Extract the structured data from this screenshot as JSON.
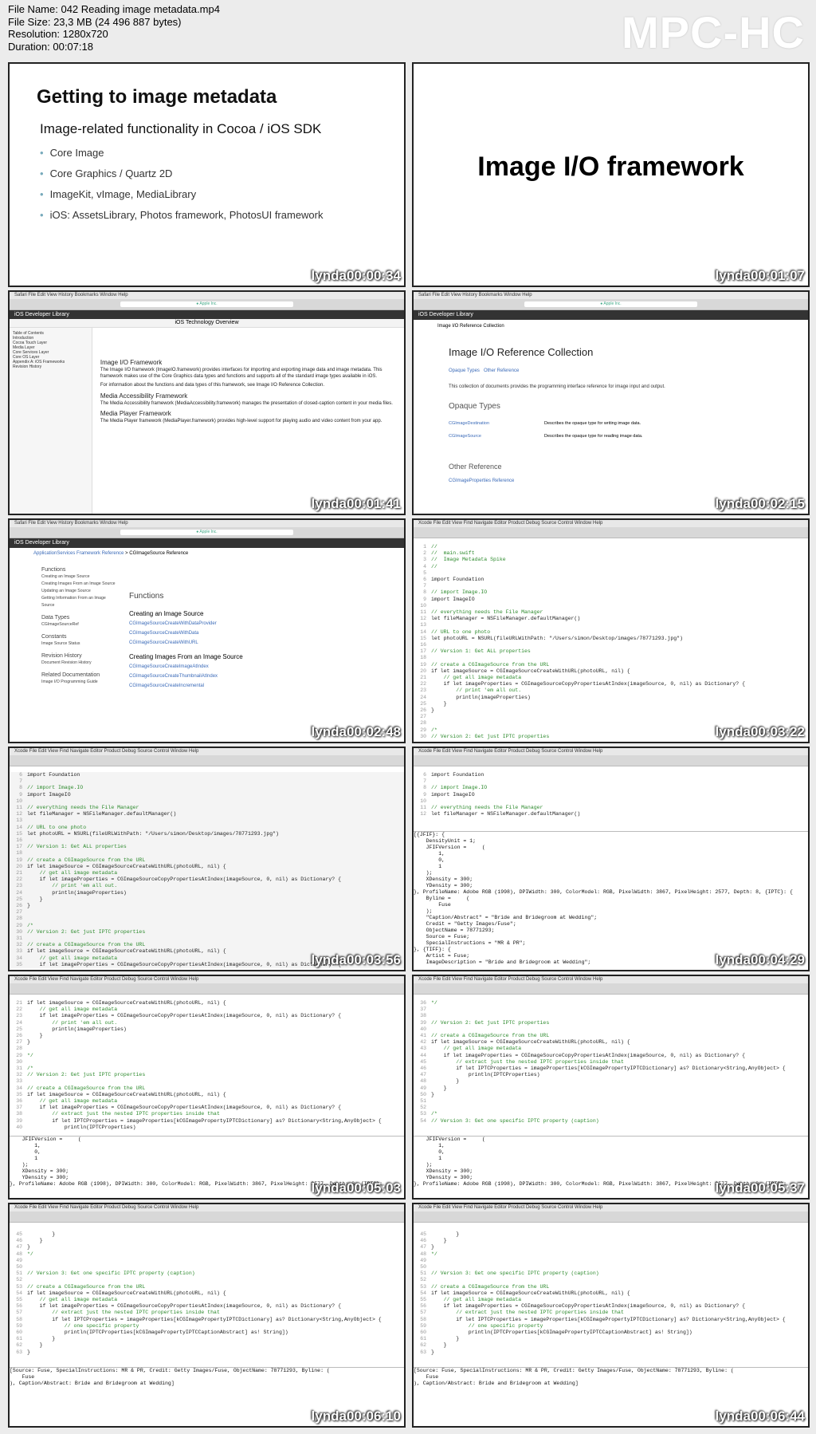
{
  "header": {
    "file_name": "File Name: 042 Reading image metadata.mp4",
    "file_size": "File Size: 23,3 MB (24 496 887 bytes)",
    "resolution": "Resolution: 1280x720",
    "duration": "Duration: 00:07:18",
    "brand": "MPC-HC"
  },
  "timestamps": {
    "t1": "lynda00:00:34",
    "t2": "lynda00:01:07",
    "t3": "lynda00:01:41",
    "t4": "lynda00:02:15",
    "t5": "lynda00:02:48",
    "t6": "lynda00:03:22",
    "t7": "lynda00:03:56",
    "t8": "lynda00:04:29",
    "t9": "lynda00:05:03",
    "t10": "lynda00:05:37",
    "t11": "lynda00:06:10",
    "t12": "lynda00:06:44"
  },
  "slide1": {
    "title": "Getting to image metadata",
    "subtitle": "Image-related functionality in Cocoa / iOS SDK",
    "bullets": [
      "Core Image",
      "Core Graphics / Quartz 2D",
      "ImageKit, vImage, MediaLibrary",
      "iOS: AssetsLibrary, Photos framework, PhotosUI framework"
    ]
  },
  "slide2": {
    "title": "Image I/O framework"
  },
  "browser1": {
    "menu": "Safari  File  Edit  View  History  Bookmarks  Window  Help",
    "bar": "iOS Developer Library",
    "page_title": "iOS Technology Overview",
    "toc": [
      "Table of Contents",
      "Introduction",
      "Cocoa Touch Layer",
      "Media Layer",
      "Core Services Layer",
      "Core OS Layer",
      "Appendix A: iOS Frameworks",
      "Revision History"
    ],
    "h1": "Image I/O Framework",
    "p1": "The Image I/O framework (ImageIO.framework) provides interfaces for importing and exporting image data and image metadata. This framework makes use of the Core Graphics data types and functions and supports all of the standard image types available in iOS.",
    "p1b": "For information about the functions and data types of this framework, see Image I/O Reference Collection.",
    "h2": "Media Accessibility Framework",
    "p2": "The Media Accessibility framework (MediaAccessibility.framework) manages the presentation of closed-caption content in your media files.",
    "h3": "Media Player Framework",
    "p3": "The Media Player framework (MediaPlayer.framework) provides high-level support for playing audio and video content from your app."
  },
  "browser2": {
    "bar": "iOS Developer Library",
    "crumb": "Image I/O Reference Collection",
    "title": "Image I/O Reference Collection",
    "links": [
      "Opaque Types",
      "Other Reference"
    ],
    "desc": "This collection of documents provides the programming interface reference for image input and output.",
    "h_opaque": "Opaque Types",
    "rows": [
      {
        "name": "CGImageDestination",
        "desc": "Describes the opaque type for writing image data."
      },
      {
        "name": "CGImageSource",
        "desc": "Describes the opaque type for reading image data."
      }
    ],
    "h_other": "Other Reference",
    "other_link": "CGImageProperties Reference"
  },
  "browser3": {
    "crumb_a": "ApplicationServices Framework Reference",
    "crumb_b": "CGImageSource Reference",
    "side": [
      "Functions",
      "Creating an Image Source",
      "Creating Images From an Image Source",
      "Updating an Image Source",
      "Getting Information From an Image Source",
      "Data Types",
      "CGImageSourceRef",
      "Constants",
      "Image Source Status",
      "Revision History",
      "Document Revision History",
      "Related Documentation",
      "Image I/O Programming Guide"
    ],
    "h_functions": "Functions",
    "h_create": "Creating an Image Source",
    "fns1": [
      "CGImageSourceCreateWithDataProvider",
      "CGImageSourceCreateWithData",
      "CGImageSourceCreateWithURL"
    ],
    "h_images": "Creating Images From an Image Source",
    "fns2": [
      "CGImageSourceCreateImageAtIndex",
      "CGImageSourceCreateThumbnailAtIndex",
      "CGImageSourceCreateIncremental"
    ]
  },
  "xcode_menu": "Xcode  File  Edit  View  Find  Navigate  Editor  Product  Debug  Source Control  Window  Help",
  "code6": [
    "//",
    "//  main.swift",
    "//  Image Metadata Spike",
    "//",
    "",
    "import Foundation",
    "",
    "// import Image.IO",
    "import ImageIO",
    "",
    "// everything needs the File Manager",
    "let fileManager = NSFileManager.defaultManager()",
    "",
    "// URL to one photo",
    "let photoURL = NSURL(fileURLWithPath: \"/Users/simon/Desktop/images/78771293.jpg\")",
    "",
    "// Version 1: Get ALL properties",
    "",
    "// create a CGImageSource from the URL",
    "if let imageSource = CGImageSourceCreateWithURL(photoURL, nil) {",
    "    // get all image metadata",
    "    if let imageProperties = CGImageSourceCopyPropertiesAtIndex(imageSource, 0, nil) as Dictionary? {",
    "        // print 'em all out.",
    "        println(imageProperties)",
    "    }",
    "}",
    "",
    "",
    "/*",
    "// Version 2: Get just IPTC properties"
  ],
  "code7": [
    "import Foundation",
    "",
    "// import Image.IO",
    "import ImageIO",
    "",
    "// everything needs the File Manager",
    "let fileManager = NSFileManager.defaultManager()",
    "",
    "// URL to one photo",
    "let photoURL = NSURL(fileURLWithPath: \"/Users/simon/Desktop/images/78771293.jpg\")",
    "",
    "// Version 1: Get ALL properties",
    "",
    "// create a CGImageSource from the URL",
    "if let imageSource = CGImageSourceCreateWithURL(photoURL, nil) {",
    "    // get all image metadata",
    "    if let imageProperties = CGImageSourceCopyPropertiesAtIndex(imageSource, 0, nil) as Dictionary? {",
    "        // print 'em all out.",
    "        println(imageProperties)",
    "    }",
    "}",
    "",
    "",
    "/*",
    "// Version 2: Get just IPTC properties",
    "",
    "// create a CGImageSource from the URL",
    "if let imageSource = CGImageSourceCreateWithURL(photoURL, nil) {",
    "    // get all image metadata",
    "    if let imageProperties = CGImageSourceCopyPropertiesAtIndex(imageSource, 0, nil) as Dictionary? {"
  ],
  "code8_top": [
    "import Foundation",
    "",
    "// import Image.IO",
    "import ImageIO",
    "",
    "// everything needs the File Manager",
    "let fileManager = NSFileManager.defaultManager()"
  ],
  "console8": [
    "[{JFIF}: {",
    "    DensityUnit = 1;",
    "    JFIFVersion =     (",
    "        1,",
    "        0,",
    "        1",
    "    );",
    "    XDensity = 300;",
    "    YDensity = 300;",
    "}, ProfileName: Adobe RGB (1998), DPIWidth: 300, ColorModel: RGB, PixelWidth: 3867, PixelHeight: 2577, Depth: 8, {IPTC}: {",
    "    Byline =     (",
    "        Fuse",
    "    );",
    "    \"Caption/Abstract\" = \"Bride and Bridegroom at Wedding\";",
    "    Credit = \"Getty Images/Fuse\";",
    "    ObjectName = 78771293;",
    "    Source = Fuse;",
    "    SpecialInstructions = \"MR & PR\";",
    "}, {TIFF}: {",
    "    Artist = Fuse;",
    "    ImageDescription = \"Bride and Bridegroom at Wedding\";"
  ],
  "code9": [
    "if let imageSource = CGImageSourceCreateWithURL(photoURL, nil) {",
    "    // get all image metadata",
    "    if let imageProperties = CGImageSourceCopyPropertiesAtIndex(imageSource, 0, nil) as Dictionary? {",
    "        // print 'em all out.",
    "        println(imageProperties)",
    "    }",
    "}",
    "",
    "*/",
    "",
    "/*",
    "// Version 2: Get just IPTC properties",
    "",
    "// create a CGImageSource from the URL",
    "if let imageSource = CGImageSourceCreateWithURL(photoURL, nil) {",
    "    // get all image metadata",
    "    if let imageProperties = CGImageSourceCopyPropertiesAtIndex(imageSource, 0, nil) as Dictionary? {",
    "        // extract just the nested IPTC properties inside that",
    "        if let IPTCProperties = imageProperties[kCGImagePropertyIPTCDictionary] as? Dictionary<String,AnyObject> {",
    "            println(IPTCProperties)"
  ],
  "console9": [
    "    JFIFVersion =     (",
    "        1,",
    "        0,",
    "        1",
    "    );",
    "    XDensity = 300;",
    "    YDensity = 300;",
    "}, ProfileName: Adobe RGB (1998), DPIWidth: 300, ColorModel: RGB, PixelWidth: 3867, PixelHeight: 2577, Depth: 8, {IPTC}:"
  ],
  "code10": [
    "*/",
    "",
    "",
    "// Version 2: Get just IPTC properties",
    "",
    "// create a CGImageSource from the URL",
    "if let imageSource = CGImageSourceCreateWithURL(photoURL, nil) {",
    "    // get all image metadata",
    "    if let imageProperties = CGImageSourceCopyPropertiesAtIndex(imageSource, 0, nil) as Dictionary? {",
    "        // extract just the nested IPTC properties inside that",
    "        if let IPTCProperties = imageProperties[kCGImagePropertyIPTCDictionary] as? Dictionary<String,AnyObject> {",
    "            println(IPTCProperties)",
    "        }",
    "    }",
    "}",
    "",
    "",
    "/*",
    "// Version 3: Get one specific IPTC property (caption)"
  ],
  "console10": [
    "    JFIFVersion =     (",
    "        1,",
    "        0,",
    "        1",
    "    );",
    "    XDensity = 300;",
    "    YDensity = 300;",
    "}, ProfileName: Adobe RGB (1998), DPIWidth: 300, ColorModel: RGB, PixelWidth: 3867, PixelHeight: 2577, Depth: 8, {IPTC}:"
  ],
  "code11": [
    "        }",
    "    }",
    "}",
    "*/",
    "",
    "",
    "// Version 3: Get one specific IPTC property (caption)",
    "",
    "// create a CGImageSource from the URL",
    "if let imageSource = CGImageSourceCreateWithURL(photoURL, nil) {",
    "    // get all image metadata",
    "    if let imageProperties = CGImageSourceCopyPropertiesAtIndex(imageSource, 0, nil) as Dictionary? {",
    "        // extract just the nested IPTC properties inside that",
    "        if let IPTCProperties = imageProperties[kCGImagePropertyIPTCDictionary] as? Dictionary<String,AnyObject> {",
    "            // one specific property",
    "            println(IPTCProperties[kCGImagePropertyIPTCCaptionAbstract] as! String])",
    "        }",
    "    }",
    "}"
  ],
  "console11": [
    "[Source: Fuse, SpecialInstructions: MR & PR, Credit: Getty Images/Fuse, ObjectName: 78771293, Byline: (",
    "    Fuse",
    "), Caption/Abstract: Bride and Bridegroom at Wedding]"
  ],
  "code12": [
    "        }",
    "    }",
    "}",
    "*/",
    "",
    "",
    "// Version 3: Get one specific IPTC property (caption)",
    "",
    "// create a CGImageSource from the URL",
    "if let imageSource = CGImageSourceCreateWithURL(photoURL, nil) {",
    "    // get all image metadata",
    "    if let imageProperties = CGImageSourceCopyPropertiesAtIndex(imageSource, 0, nil) as Dictionary? {",
    "        // extract just the nested IPTC properties inside that",
    "        if let IPTCProperties = imageProperties[kCGImagePropertyIPTCDictionary] as? Dictionary<String,AnyObject> {",
    "            // one specific property",
    "            println(IPTCProperties[kCGImagePropertyIPTCCaptionAbstract] as! String])",
    "        }",
    "    }",
    "}"
  ],
  "console12": [
    "[Source: Fuse, SpecialInstructions: MR & PR, Credit: Getty Images/Fuse, ObjectName: 78771293, Byline: (",
    "    Fuse",
    "), Caption/Abstract: Bride and Bridegroom at Wedding]"
  ]
}
